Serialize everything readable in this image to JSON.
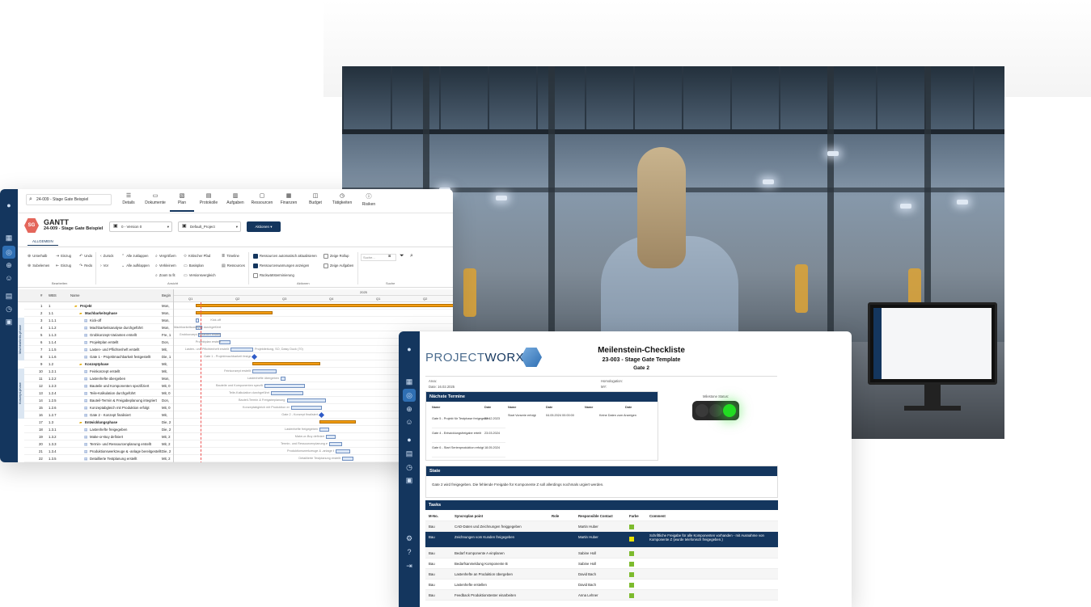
{
  "gantt": {
    "search": "24-009 - Stage Gate Beispiel",
    "nav": [
      "Details",
      "Dokumente",
      "Plan",
      "Protokolle",
      "Aufgaben",
      "Ressourcen",
      "Finanzen",
      "Budget",
      "Tätigkeiten",
      "Risiken"
    ],
    "badge": "SG",
    "title": "GANTT",
    "subtitle": "24-009 - Stage Gate Beispiel",
    "version": "0 - Version 0",
    "project": "Default_Project",
    "actions": "Aktionen",
    "tab": "ALLGEMEIN",
    "ribbon": {
      "b1": "Unterhalb",
      "b2": "Einzug",
      "b3": "Undo",
      "b4": "Subelemen",
      "b5": "Einzug",
      "b6": "Redo",
      "b7": "Zurück",
      "b8": "Alle zuklappen",
      "b9": "Vergrößern",
      "b10": "Kritischer Pfad",
      "b11": "Timeline",
      "b12": "Vor",
      "b13": "Alle aufklappen",
      "b14": "Verkleinern",
      "b15": "Basisplan",
      "b16": "Ressources",
      "b17": "Zoom to fit",
      "b18": "Versionsvergleich",
      "c1": "Ressourcen automatisch aktualisieren",
      "c2": "Zeige Rollup",
      "c3": "Ressourcenwarnungen anzeigen",
      "c4": "Zeige Aufgaben",
      "c5": "Rückwärtsterminierung",
      "search": "Suche...",
      "g1": "Bearbeiten",
      "g2": "Ansicht",
      "g3": "Aktionen",
      "g4": "Suche"
    },
    "cols": {
      "num": "#",
      "wbs": "WBS",
      "name": "Name",
      "begin": "Begin"
    },
    "years": [
      "2025"
    ],
    "quarters": [
      "Q1",
      "Q2",
      "Q3",
      "Q4",
      "Q1",
      "Q2"
    ],
    "phases": [
      "Machbarkeits-phase",
      "Konzept-phase"
    ],
    "rows": [
      {
        "n": "1",
        "w": "1",
        "name": "Projekt",
        "b": "Mon,"
      },
      {
        "n": "2",
        "w": "1.1",
        "name": "Machbarkeitsphase",
        "b": "Mon,"
      },
      {
        "n": "3",
        "w": "1.1.1",
        "name": "Kick-off",
        "b": "Mon,"
      },
      {
        "n": "4",
        "w": "1.1.2",
        "name": "Machbarkeitsanalyse durchgeführt",
        "b": "Mon,"
      },
      {
        "n": "5",
        "w": "1.1.3",
        "name": "Grobkonzept-Varianten erstellt",
        "b": "Fre, 1"
      },
      {
        "n": "6",
        "w": "1.1.4",
        "name": "Projektplan erstellt",
        "b": "Don,"
      },
      {
        "n": "7",
        "w": "1.1.5",
        "name": "Lasten- und Pflichtenheft erstellt",
        "b": "Mit,"
      },
      {
        "n": "8",
        "w": "1.1.6",
        "name": "Gate 1 - Projektmachbarkeit festgestellt",
        "b": "Die, 1"
      },
      {
        "n": "9",
        "w": "1.2",
        "name": "Konzeptphase",
        "b": "Mit,"
      },
      {
        "n": "10",
        "w": "1.2.1",
        "name": "Feinkonzept erstellt",
        "b": "Mit,"
      },
      {
        "n": "11",
        "w": "1.2.2",
        "name": "Lastenhefte übergeben",
        "b": "Mon,"
      },
      {
        "n": "12",
        "w": "1.2.3",
        "name": "Bauteile und Komponenten spezifiziert",
        "b": "Mit, 0"
      },
      {
        "n": "13",
        "w": "1.2.4",
        "name": "Teile-Kalkulation durchgeführt",
        "b": "Mit, 0"
      },
      {
        "n": "14",
        "w": "1.2.5",
        "name": "Bauteil-Termin & Freigabeplanung integriert",
        "b": "Don,"
      },
      {
        "n": "15",
        "w": "1.2.6",
        "name": "Konzeptabgleich mit Produktion erfolgt",
        "b": "Mit, 0"
      },
      {
        "n": "16",
        "w": "1.2.7",
        "name": "Gate 2 - Konzept finalisiert",
        "b": "Mit,"
      },
      {
        "n": "17",
        "w": "1.3",
        "name": "Entwicklungsphase",
        "b": "Die, 2"
      },
      {
        "n": "18",
        "w": "1.3.1",
        "name": "Lastenhefte freigegeben",
        "b": "Die, 2"
      },
      {
        "n": "19",
        "w": "1.3.2",
        "name": "Make-or-Buy definiert",
        "b": "Mit, 2"
      },
      {
        "n": "20",
        "w": "1.3.3",
        "name": "Termin- und Ressourcenplanung erstellt",
        "b": "Mit, 2"
      },
      {
        "n": "21",
        "w": "1.3.4",
        "name": "Produktionswerkzeuge & -anlage bereitgestellt",
        "b": "Die, 2"
      },
      {
        "n": "22",
        "w": "1.3.5",
        "name": "Detaillierte Testplanung erstellt",
        "b": "Mit, 2"
      }
    ],
    "barlabels": [
      "Kick-off",
      "Machbarkeitsanalyse durchgeführt",
      "Grobkonzept-Varianten erstellt",
      "Projektplan erstellt",
      "Lasten- und Pflichtenheft erstellt",
      "Gate 1 - Projektmachbarkeit festgestellt",
      "Projektleitung, SO, Daisy Duck (70)",
      "Feinkonzept erstellt",
      "Lastenhefte übergeben",
      "Bauteile und Komponenten spezifiziert",
      "Teile-Kalkulation durchgeführt",
      "Bauteil-Termin & Freigabeplanung integriert",
      "Konzeptabgleich mit Produktion erfolgt",
      "Gate 2 - Konzept finalisiert",
      "Lastenhefte freigegeben",
      "Make-or-Buy definiert",
      "Termin- und Ressourcenplanung erstellt",
      "Produktionswerkzeuge & -anlage bereitgestellt",
      "Detaillierte Testplanung erstellt"
    ]
  },
  "check": {
    "logo_a": "PROJECT",
    "logo_b": "WORX",
    "title": "Meilenstein-Checkliste",
    "subtitle": "23-003 - Stage Gate Template",
    "gate": "Gate 2",
    "area": "Area:",
    "date": "Date: 16.02.2025",
    "homologation": "Homologation:",
    "my": "MY:",
    "next_title": "Nächste Termine",
    "name_h": "Name",
    "date_h": "Date",
    "next": [
      {
        "name": "Gate 5 - Projekt für Testphase freigegeben",
        "date": "22.12.2023"
      },
      {
        "name": "Gate 4 - Entwicklungsfreigabe erteilt",
        "date": "23.03.2024"
      },
      {
        "name": "Gate 6 - Start Serienproduktion erfolgt",
        "date": "18.05.2024"
      }
    ],
    "next2": {
      "name": "Start Vorserie erfolgt",
      "date": "04.05.2024 00:00:00"
    },
    "none": "Keine Daten zum Anzeigen",
    "ms_status": "Milestone Status:",
    "state_title": "State",
    "state_text": "Gate 2 wird freigegeben. Die fehlende Freigabe für Komponente Z soll allerdings nochmals urgiert werden.",
    "tasks_title": "Tasks",
    "cols": [
      "M-No.",
      "Syncroplan point",
      "Role",
      "Responsible Contact",
      "Farbe",
      "Comment"
    ],
    "tasks": [
      {
        "m": "Bau",
        "p": "CAD-Daten und Zeichnungen freiggegeben",
        "r": "",
        "c": "Martin Huber",
        "col": "#7dbb2e",
        "cm": ""
      },
      {
        "m": "Bau",
        "p": "Zeichnungen vom Kunden freigegeben",
        "r": "",
        "c": "Martin Huber",
        "col": "#e8e000",
        "cm": "Schriftliche Freigabe für alle Komponenten vorhanden - mit Ausnahme von Komponente Z (wurde telefonisch freigegeben.)"
      },
      {
        "m": "Bau",
        "p": "Bedarf Komponente A einplanen",
        "r": "",
        "c": "Sabine Holl",
        "col": "#7dbb2e",
        "cm": ""
      },
      {
        "m": "Bau",
        "p": "Bedarfsanmeldung Komponente B",
        "r": "",
        "c": "Sabine Holl",
        "col": "#7dbb2e",
        "cm": ""
      },
      {
        "m": "Bau",
        "p": "Lastenhefte an Produktion übergeben",
        "r": "",
        "c": "David Bach",
        "col": "#7dbb2e",
        "cm": ""
      },
      {
        "m": "Bau",
        "p": "Lastenhefte erstellen",
        "r": "",
        "c": "David Bach",
        "col": "#7dbb2e",
        "cm": ""
      },
      {
        "m": "Bau",
        "p": "Feedback Produktionstester einarbeiten",
        "r": "",
        "c": "Anna Lehner",
        "col": "#7dbb2e",
        "cm": ""
      }
    ]
  }
}
